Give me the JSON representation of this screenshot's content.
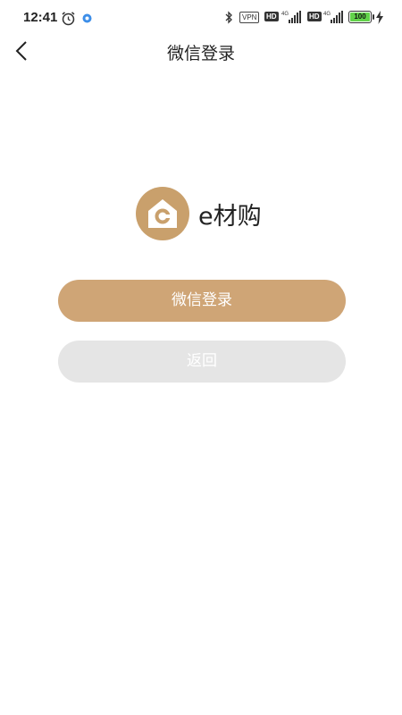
{
  "status_bar": {
    "time": "12:41",
    "vpn_label": "VPN",
    "hd_label_1": "HD",
    "hd_label_2": "HD",
    "network_type_1": "4G",
    "network_type_2": "4G",
    "battery_level": "100"
  },
  "nav": {
    "title": "微信登录"
  },
  "brand": {
    "app_name": "e材购",
    "logo_color": "#c9a06c"
  },
  "actions": {
    "wechat_login_label": "微信登录",
    "back_label": "返回"
  },
  "colors": {
    "primary_button": "#cfa576",
    "secondary_button": "#e5e5e5",
    "battery": "#62d34a"
  }
}
